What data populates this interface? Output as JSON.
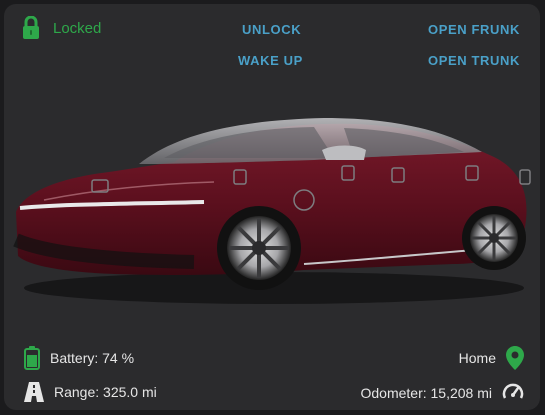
{
  "lock": {
    "status": "Locked",
    "icon": "lock-icon",
    "color": "#2ea84a"
  },
  "actions": {
    "unlock": "UNLOCK",
    "wake_up": "WAKE UP",
    "open_frunk": "OPEN FRUNK",
    "open_trunk": "OPEN TRUNK",
    "accent": "#4aa0c8"
  },
  "car": {
    "image": "car-image",
    "color": "#6b1524"
  },
  "stats": {
    "battery": {
      "label": "Battery: 74 %",
      "icon": "battery-icon",
      "level": 0.74,
      "color": "#2ea84a"
    },
    "range": {
      "label": "Range: 325.0 mi",
      "icon": "road-icon"
    },
    "location": {
      "label": "Home",
      "icon": "map-pin-icon",
      "color": "#2ea84a"
    },
    "odometer": {
      "label": "Odometer: 15,208 mi",
      "icon": "speedometer-icon"
    }
  }
}
